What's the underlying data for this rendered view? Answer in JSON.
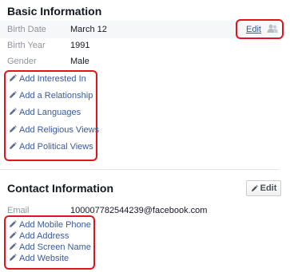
{
  "basic": {
    "title": "Basic Information",
    "edit_label": "Edit",
    "audience_icon": "friends-icon",
    "fields": [
      {
        "label": "Birth Date",
        "value": "March 12"
      },
      {
        "label": "Birth Year",
        "value": "1991"
      },
      {
        "label": "Gender",
        "value": "Male"
      }
    ],
    "add_items": [
      "Add Interested In",
      "Add a Relationship",
      "Add Languages",
      "Add Religious Views",
      "Add Political Views"
    ]
  },
  "contact": {
    "title": "Contact Information",
    "edit_button_label": "Edit",
    "fields": [
      {
        "label": "Email",
        "value": "100007782544239@facebook.com"
      }
    ],
    "add_items": [
      "Add Mobile Phone",
      "Add Address",
      "Add Screen Name",
      "Add Website"
    ]
  },
  "colors": {
    "link": "#3b5998",
    "highlight_box": "#e0141e",
    "label_gray": "#90949c"
  }
}
